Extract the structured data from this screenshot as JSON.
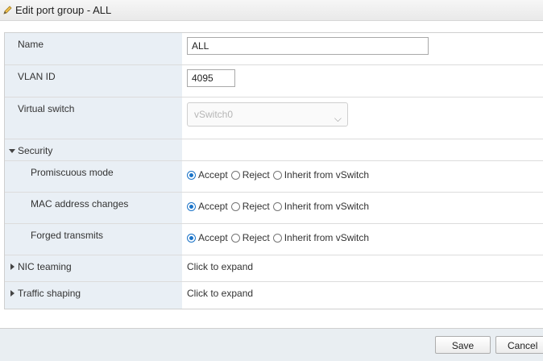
{
  "window": {
    "title": "Edit port group - ALL"
  },
  "form": {
    "name": {
      "label": "Name",
      "value": "ALL"
    },
    "vlan": {
      "label": "VLAN ID",
      "value": "4095"
    },
    "vswitch": {
      "label": "Virtual switch",
      "value": "vSwitch0"
    },
    "security": {
      "label": "Security",
      "rows": [
        {
          "label": "Promiscuous mode",
          "selected": "Accept"
        },
        {
          "label": "MAC address changes",
          "selected": "Accept"
        },
        {
          "label": "Forged transmits",
          "selected": "Accept"
        }
      ],
      "options": [
        "Accept",
        "Reject",
        "Inherit from vSwitch"
      ]
    },
    "nic_teaming": {
      "label": "NIC teaming",
      "value": "Click to expand"
    },
    "traffic_shaping": {
      "label": "Traffic shaping",
      "value": "Click to expand"
    }
  },
  "footer": {
    "save_label": "Save",
    "cancel_label": "Cancel"
  },
  "colors": {
    "label_bg": "#e9eff5",
    "accent": "#1a73c8",
    "footer_bg": "#e9eef2"
  }
}
